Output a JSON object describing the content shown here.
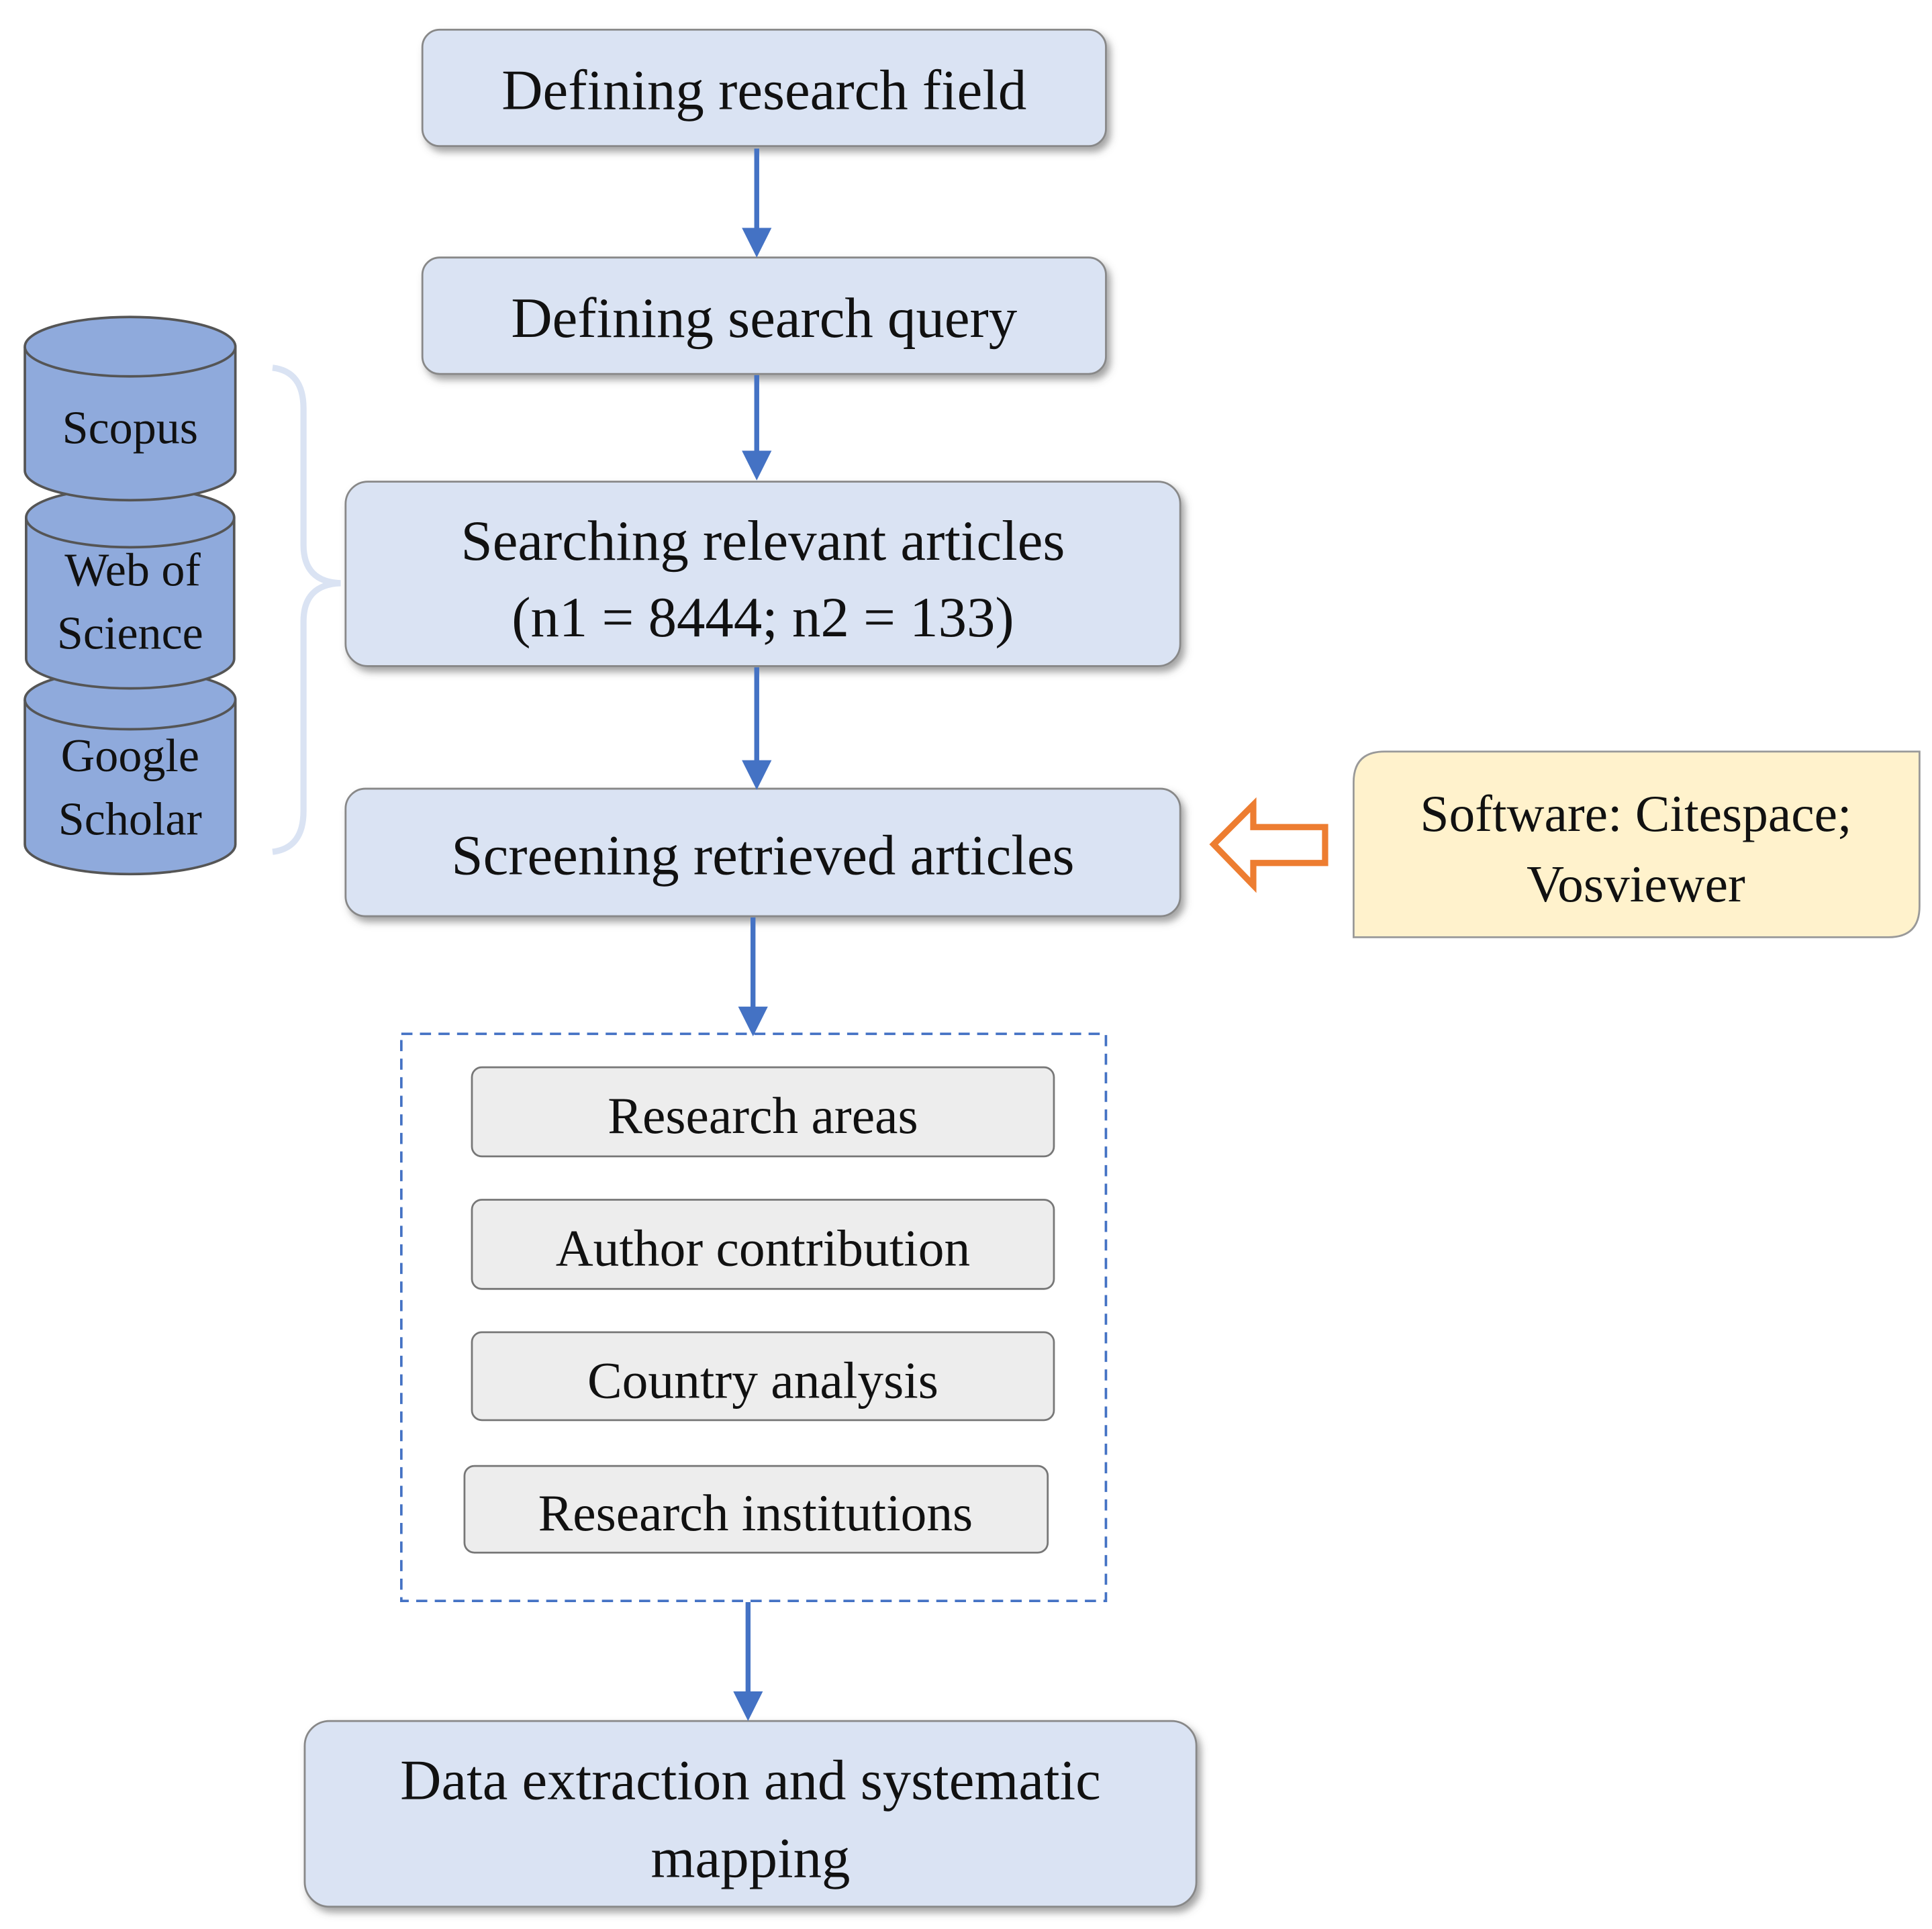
{
  "steps": {
    "define_field": "Defining research field",
    "define_query": "Defining search query",
    "search_line1": "Searching relevant articles",
    "search_line2": "(n1 = 8444; n2 = 133)",
    "screening": "Screening retrieved articles",
    "final_line1": "Data extraction and systematic",
    "final_line2": "mapping"
  },
  "databases": {
    "scopus": "Scopus",
    "wos_line1": "Web of",
    "wos_line2": "Science",
    "gs_line1": "Google",
    "gs_line2": "Scholar"
  },
  "software": {
    "line1": "Software: Citespace;",
    "line2": "Vosviewer"
  },
  "analyses": [
    "Research areas",
    "Author contribution",
    "Country analysis",
    "Research institutions"
  ],
  "colors": {
    "step_fill": "#dae3f3",
    "db_fill": "#8faadc",
    "arrow": "#4472c4",
    "orange_arrow": "#ed7d31",
    "software_fill": "#fff2cc",
    "analysis_fill": "#ededed"
  }
}
